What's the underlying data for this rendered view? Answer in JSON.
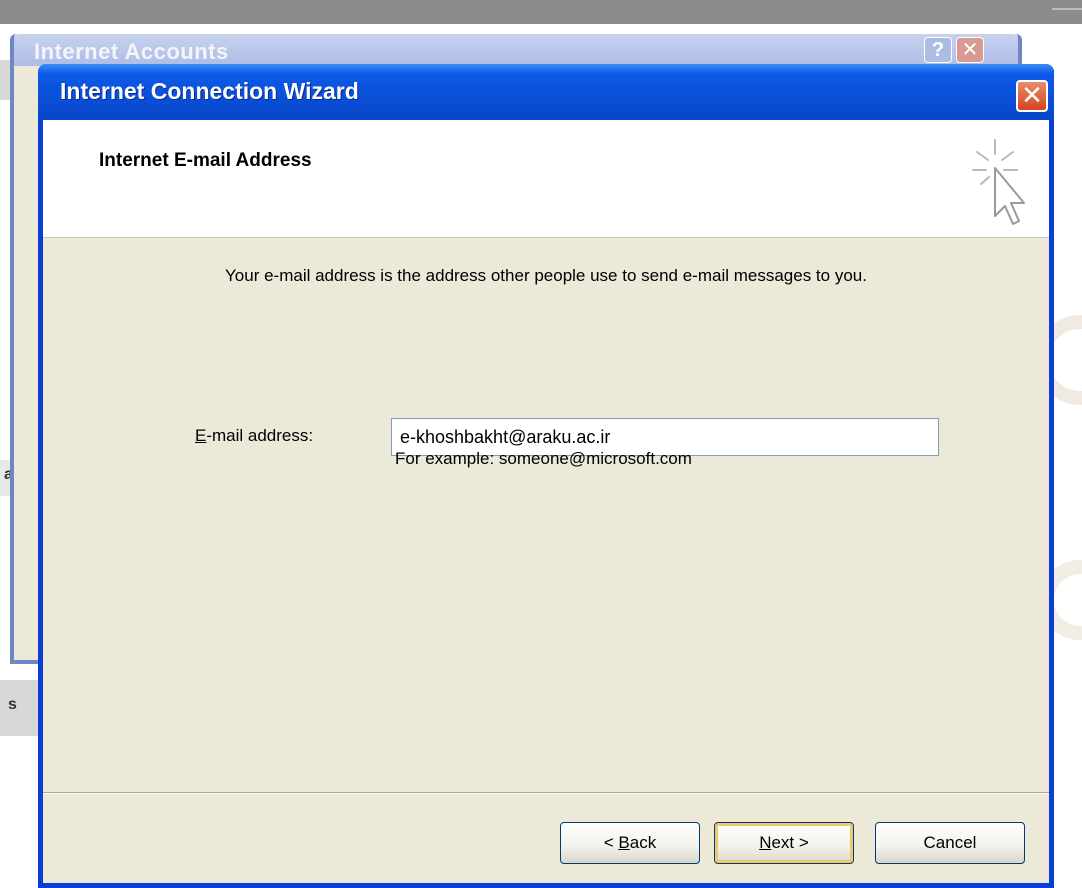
{
  "background_window": {
    "title": "Internet Accounts",
    "help_button": "?",
    "close_button": "✕",
    "side_fragment_1": "a",
    "side_fragment_2": "s"
  },
  "wizard": {
    "title": "Internet Connection Wizard",
    "close_button": "✕",
    "header_title": "Internet E-mail Address",
    "icon": "wizard-cursor-sparkle-icon",
    "description": "Your e-mail address is the address other people use to send e-mail messages to you.",
    "field": {
      "label_accesskey": "E",
      "label_rest": "-mail address:",
      "value": "e-khoshbakht@araku.ac.ir",
      "example": "For example: someone@microsoft.com"
    },
    "buttons": {
      "back_prefix": "< ",
      "back_accesskey": "B",
      "back_rest": "ack",
      "next_accesskey": "N",
      "next_rest": "ext >",
      "cancel": "Cancel"
    }
  },
  "colors": {
    "titlebar": "#0a4fd8",
    "window_face": "#ece9d8",
    "close_button": "#d4451e",
    "default_button_highlight": "#f0c86a"
  }
}
